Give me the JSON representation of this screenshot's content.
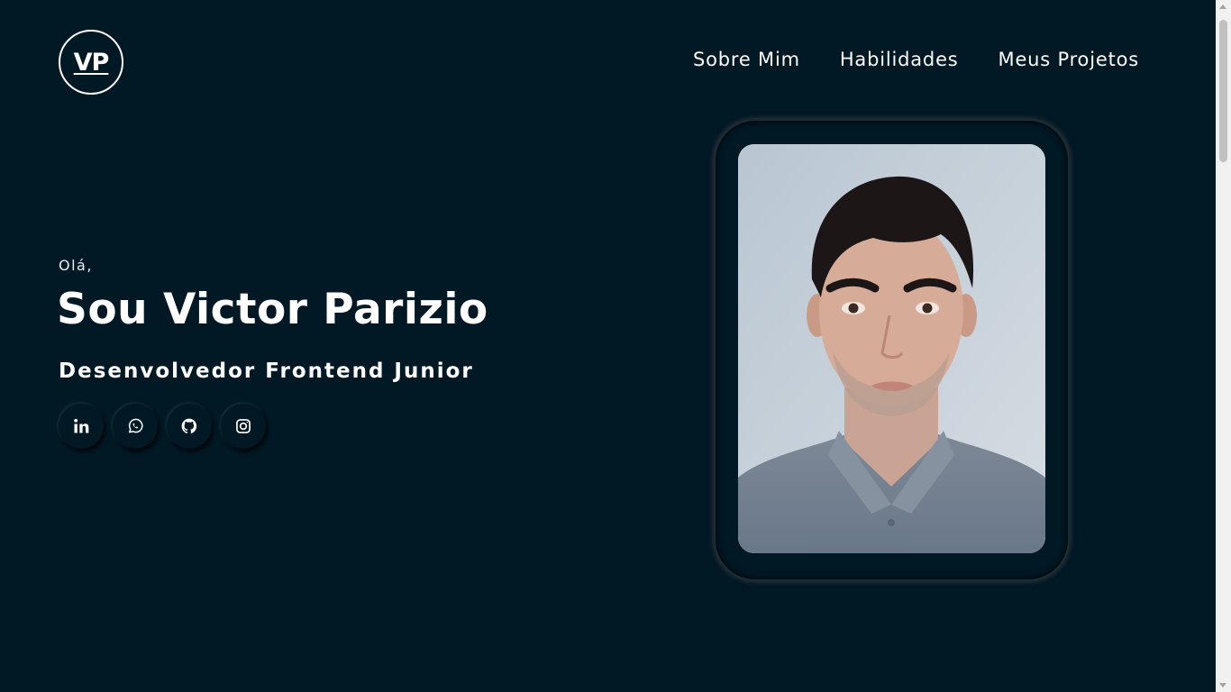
{
  "header": {
    "logo_text": "VP",
    "nav": [
      {
        "label": "Sobre Mim"
      },
      {
        "label": "Habilidades"
      },
      {
        "label": "Meus Projetos"
      }
    ]
  },
  "hero": {
    "greeting": "Olá,",
    "name": "Sou Victor Parizio",
    "role": "Desenvolvedor Frontend Junior",
    "socials": [
      {
        "icon": "linkedin-icon"
      },
      {
        "icon": "whatsapp-icon"
      },
      {
        "icon": "github-icon"
      },
      {
        "icon": "instagram-icon"
      }
    ]
  },
  "profile_photo": {
    "subject": "portrait photo"
  },
  "colors": {
    "background": "#011825",
    "text": "#ffffff"
  }
}
